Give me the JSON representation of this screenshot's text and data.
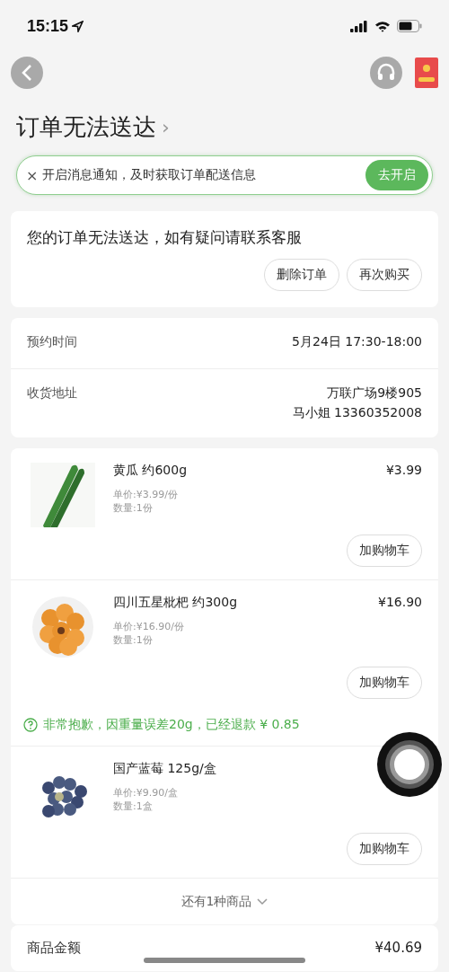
{
  "status_bar": {
    "time": "15:15"
  },
  "header": {
    "title": "订单无法送达",
    "title_chevron": "›"
  },
  "notice": {
    "close": "×",
    "text": "开启消息通知，及时获取订单配送信息",
    "button": "去开启"
  },
  "status_card": {
    "message": "您的订单无法送达，如有疑问请联系客服",
    "buttons": [
      "删除订单",
      "再次购买"
    ]
  },
  "info": [
    {
      "label": "预约时间",
      "lines": [
        "5月24日 17:30-18:00"
      ]
    },
    {
      "label": "收货地址",
      "lines": [
        "万联广场9楼905",
        "马小姐 13360352008"
      ]
    }
  ],
  "items": [
    {
      "kind": "cucumber",
      "name": "黄瓜 约600g",
      "price": "¥3.99",
      "unit_price": "单价:¥3.99/份",
      "quantity": "数量:1份",
      "button": "加购物车"
    },
    {
      "kind": "loquat",
      "name": "四川五星枇杷 约300g",
      "price": "¥16.90",
      "unit_price": "单价:¥16.90/份",
      "quantity": "数量:1份",
      "button": "加购物车",
      "refund_note": "非常抱歉，因重量误差20g，已经退款 ¥ 0.85"
    },
    {
      "kind": "blueberry",
      "name": "国产蓝莓 125g/盒",
      "unit_price": "单价:¥9.90/盒",
      "quantity": "数量:1盒",
      "button": "加购物车"
    }
  ],
  "more_items": "还有1种商品",
  "summary": [
    {
      "label": "商品金额",
      "value": "¥40.69"
    }
  ]
}
